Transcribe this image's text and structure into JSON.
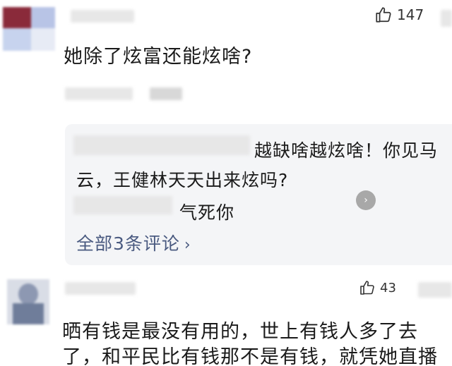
{
  "comment1": {
    "like_count": "147",
    "text": "她除了炫富还能炫啥?"
  },
  "reply_thread": {
    "reply1_line1": "越缺啥越炫啥！你见马",
    "reply1_line2": "云，王健林天天出来炫吗?",
    "reply2_text": "气死你",
    "more_label": "全部3条评论",
    "more_chevron": "›",
    "expand_glyph": "›"
  },
  "comment2": {
    "like_count": "43",
    "line1": "晒有钱是最没有用的，世上有钱人多了去",
    "line2": "了，和平民比有钱那不是有钱，就凭她直播"
  },
  "icons": {
    "like": "thumbs-up-icon",
    "chevron": "chevron-right-icon"
  }
}
